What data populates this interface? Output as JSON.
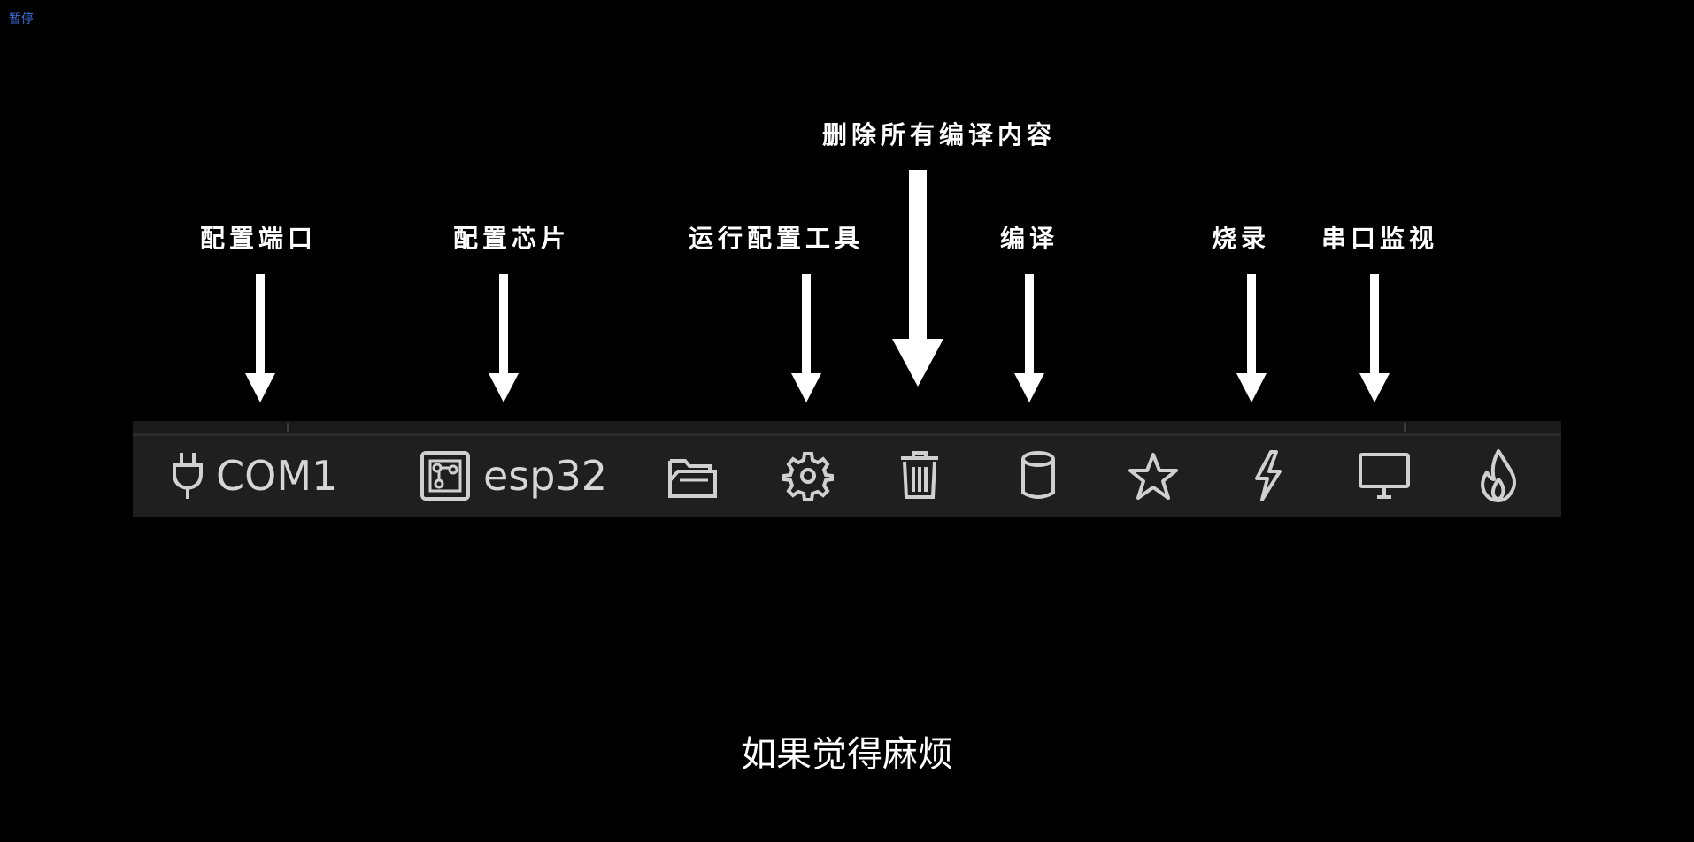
{
  "pause_link": "暂停",
  "annotations": {
    "port": "配置端口",
    "chip": "配置芯片",
    "config_tool": "运行配置工具",
    "delete_all": "删除所有编译内容",
    "compile": "编译",
    "flash": "烧录",
    "serial_monitor": "串口监视"
  },
  "toolbar": {
    "port_label": "COM1",
    "chip_label": "esp32",
    "icons": [
      "plug-icon",
      "chip-icon",
      "folder-icon",
      "gear-icon",
      "trash-icon",
      "cylinder-icon",
      "star-icon",
      "lightning-icon",
      "monitor-icon",
      "flame-icon"
    ],
    "icon_color": "#d0d0d0",
    "background_color": "#1f1f1f"
  },
  "subtitle": "如果觉得麻烦",
  "colors": {
    "background": "#000000",
    "annotation_text": "#ffffff",
    "link": "#3d6fe0"
  }
}
